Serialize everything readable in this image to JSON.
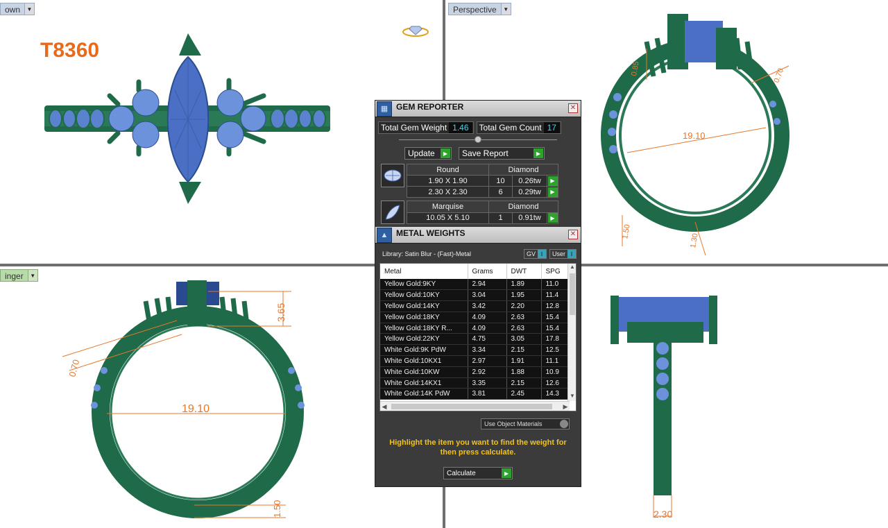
{
  "viewports": {
    "top_left": {
      "label": "own",
      "sku": "T8360"
    },
    "top_right": {
      "label": "Perspective",
      "dims": [
        "19.10",
        "0.70",
        "0.85",
        "1.50",
        "1.30"
      ]
    },
    "bottom_left": {
      "label": "inger",
      "dims": [
        "19.10",
        "3.65",
        "0.70",
        "1.50"
      ]
    },
    "bottom_right": {
      "dims": [
        "2.30"
      ]
    }
  },
  "gem_reporter": {
    "title": "GEM REPORTER",
    "total_weight_label": "Total Gem Weight",
    "total_weight_value": "1.46",
    "total_count_label": "Total Gem Count",
    "total_count_value": "17",
    "update_label": "Update",
    "save_report_label": "Save Report",
    "gems": [
      {
        "shape": "Round",
        "material": "Diamond",
        "rows": [
          {
            "size": "1.90 X 1.90",
            "count": "10",
            "weight": "0.26tw"
          },
          {
            "size": "2.30 X 2.30",
            "count": "6",
            "weight": "0.29tw"
          }
        ]
      },
      {
        "shape": "Marquise",
        "material": "Diamond",
        "rows": [
          {
            "size": "10.05 X 5.10",
            "count": "1",
            "weight": "0.91tw"
          }
        ]
      }
    ]
  },
  "metal_weights": {
    "title": "METAL WEIGHTS",
    "library_label": "Library: Satin Blur - (Fast)-Metal",
    "gv_label": "GV",
    "user_label": "User",
    "columns": [
      "Metal",
      "Grams",
      "DWT",
      "SPG"
    ],
    "rows": [
      [
        "Yellow Gold:9KY",
        "2.94",
        "1.89",
        "11.0"
      ],
      [
        "Yellow Gold:10KY",
        "3.04",
        "1.95",
        "11.4"
      ],
      [
        "Yellow Gold:14KY",
        "3.42",
        "2.20",
        "12.8"
      ],
      [
        "Yellow Gold:18KY",
        "4.09",
        "2.63",
        "15.4"
      ],
      [
        "Yellow Gold:18KY R...",
        "4.09",
        "2.63",
        "15.4"
      ],
      [
        "Yellow Gold:22KY",
        "4.75",
        "3.05",
        "17.8"
      ],
      [
        "White Gold:9K PdW",
        "3.34",
        "2.15",
        "12.5"
      ],
      [
        "White Gold:10KX1",
        "2.97",
        "1.91",
        "11.1"
      ],
      [
        "White Gold:10KW",
        "2.92",
        "1.88",
        "10.9"
      ],
      [
        "White Gold:14KX1",
        "3.35",
        "2.15",
        "12.6"
      ],
      [
        "White Gold:14K PdW",
        "3.81",
        "2.45",
        "14.3"
      ]
    ],
    "use_object_label": "Use Object Materials",
    "hint": "Highlight the item you want to find the weight for then press calculate.",
    "calculate_label": "Calculate"
  },
  "colors": {
    "metal": "#1f6a48",
    "gem": "#4a6fc4",
    "dimension": "#e8772a",
    "panel_bg": "#3b3b3b",
    "accent_value": "#4fd0e6",
    "hint": "#f3c21b"
  },
  "icons": [
    "dropdown-arrow-icon",
    "gem-reporter-icon",
    "close-icon",
    "go-arrow-icon",
    "round-gem-icon",
    "marquise-gem-icon",
    "metal-weights-icon",
    "ring-thumbnail-icon"
  ]
}
